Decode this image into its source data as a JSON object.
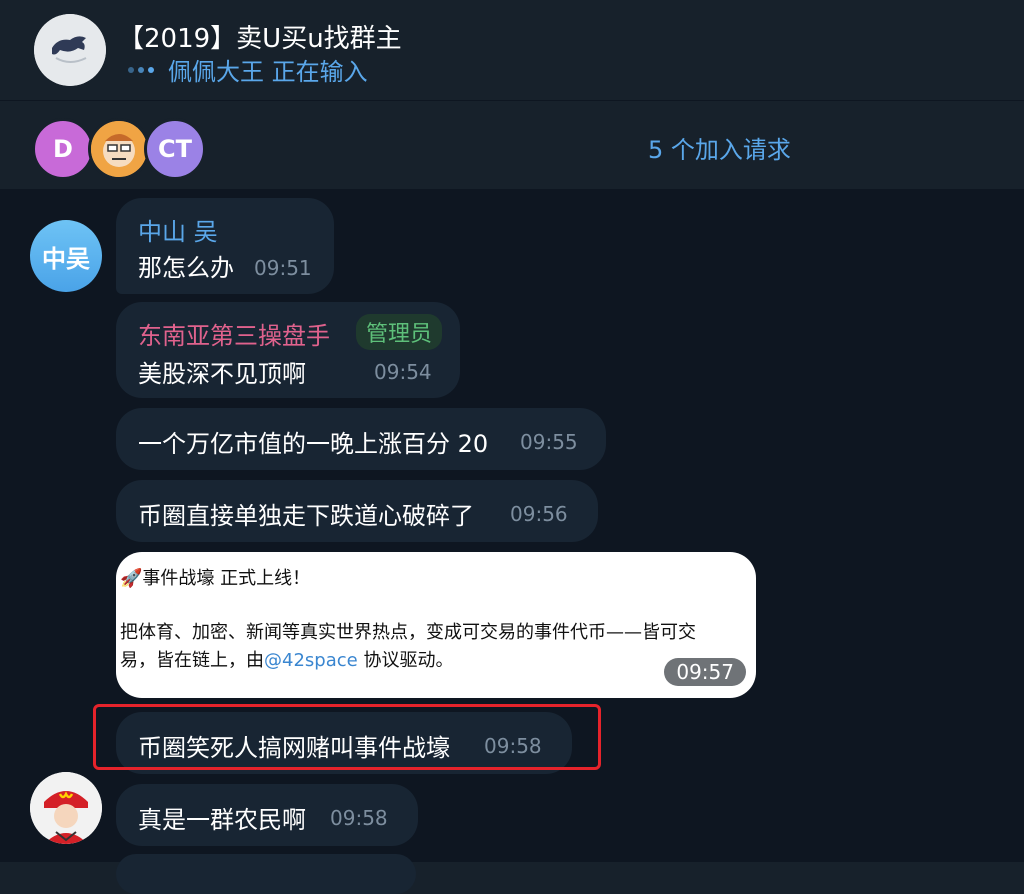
{
  "header": {
    "title": "【2019】卖U买u找群主",
    "typing": "佩佩大王 正在输入",
    "avatar_icon": "bull-logo-icon"
  },
  "join_bar": {
    "avatars": [
      {
        "initials": "D",
        "color": "#c86ad8"
      },
      {
        "icon": "cartoon-face-icon",
        "color": "#f0a444"
      },
      {
        "initials": "CT",
        "color": "#9b82e6"
      }
    ],
    "requests_text": "5 个加入请求"
  },
  "messages": [
    {
      "sender": "中山 吴",
      "sender_color": "#5aa7ea",
      "avatar_initials": "中吴",
      "text": "那怎么办",
      "time": "09:51"
    },
    {
      "sender": "东南亚第三操盘手",
      "sender_color": "#e0628d",
      "badge": "管理员",
      "text": "美股深不见顶啊",
      "time": "09:54"
    },
    {
      "text": "一个万亿市值的一晚上涨百分 20",
      "time": "09:55"
    },
    {
      "text": "币圈直接单独走下跌道心破碎了",
      "time": "09:56"
    },
    {
      "card": {
        "line1": "🚀事件战壕 正式上线！",
        "line2": "把体育、加密、新闻等真实世界热点，变成可交易的事件代币——皆可交",
        "line3_pre": "易，皆在链上，由",
        "line3_mention": "@42space",
        "line3_post": " 协议驱动。",
        "time": "09:57"
      }
    },
    {
      "text": "币圈笑死人搞网赌叫事件战壕",
      "time": "09:58",
      "highlighted": true
    },
    {
      "text": "真是一群农民啊",
      "time": "09:58",
      "avatar_icon": "mcdonalds-cap-avatar-icon"
    }
  ]
}
